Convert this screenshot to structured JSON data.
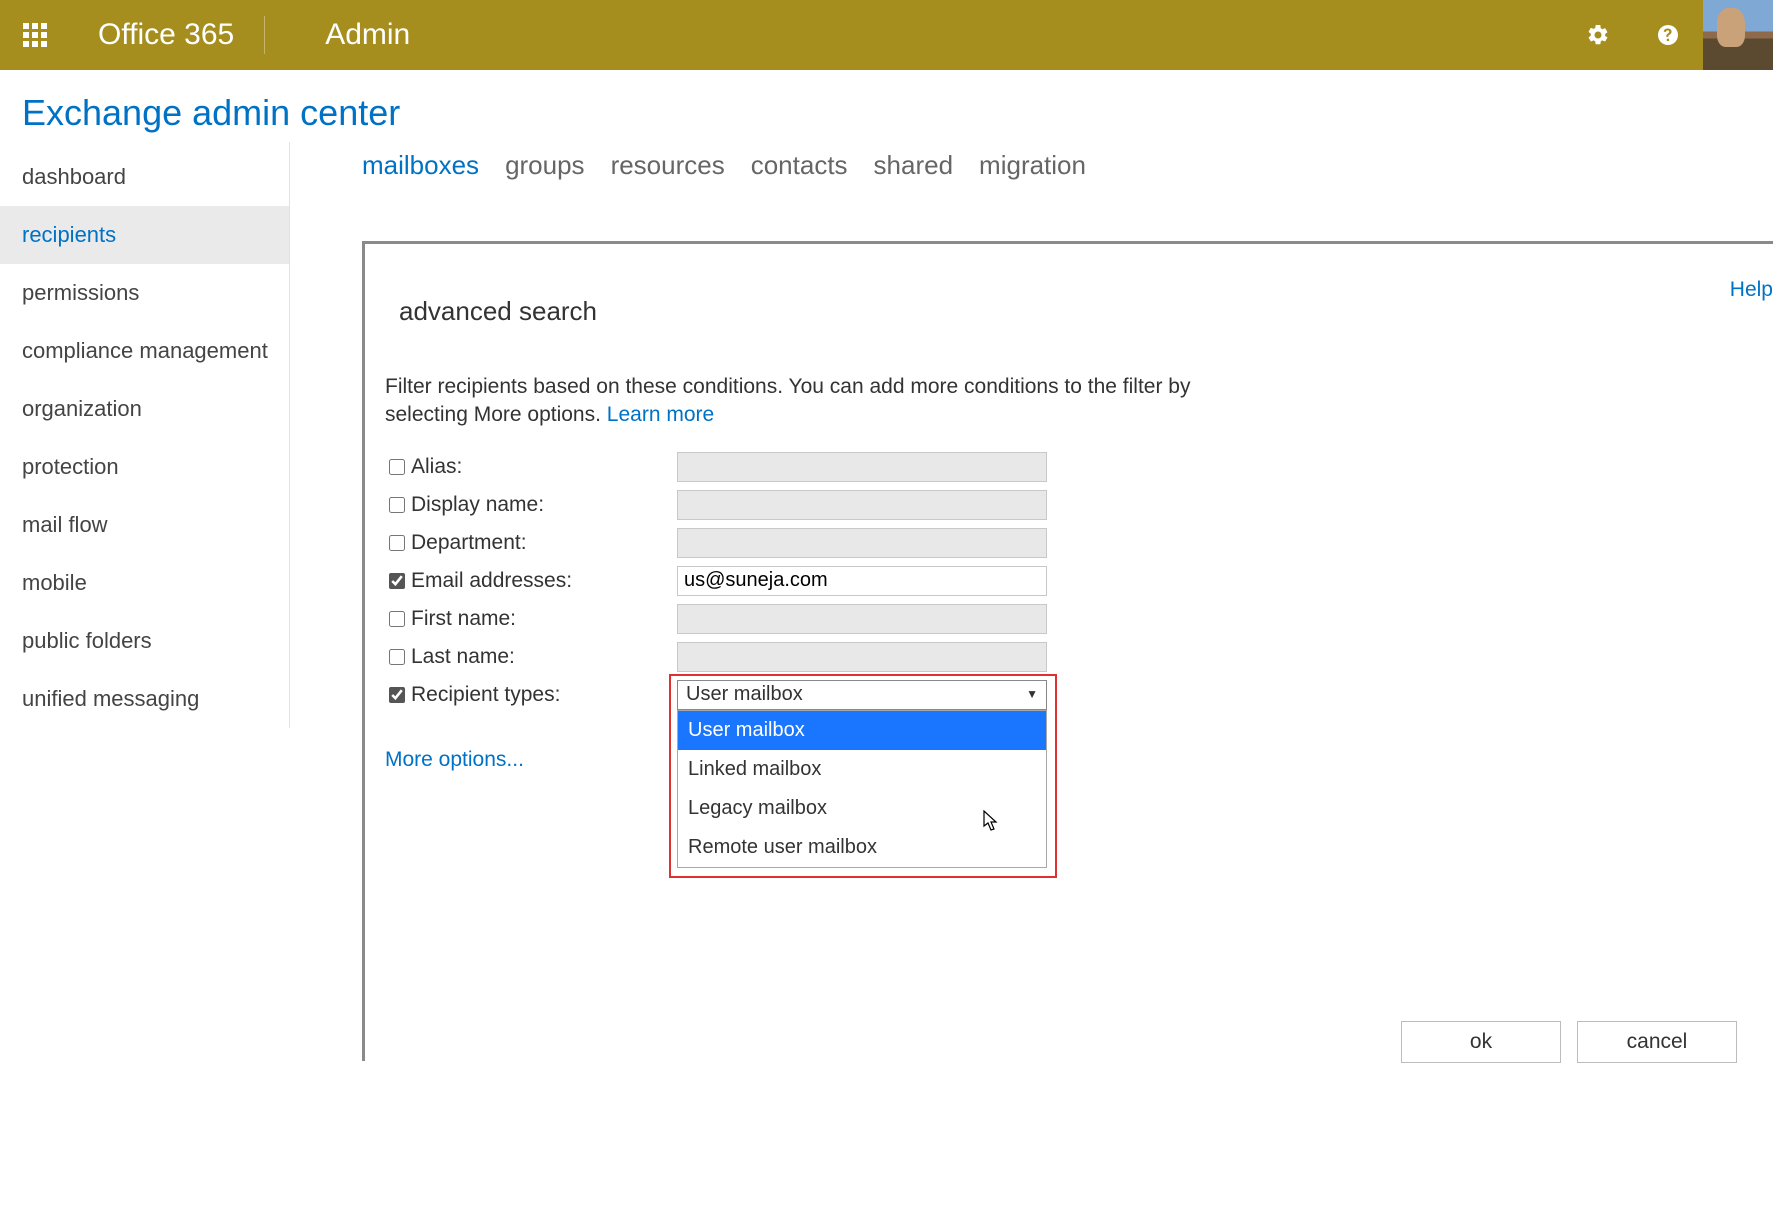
{
  "topbar": {
    "brand1": "Office 365",
    "brand2": "Admin"
  },
  "page_title": "Exchange admin center",
  "sidebar": {
    "items": [
      {
        "label": "dashboard",
        "selected": false
      },
      {
        "label": "recipients",
        "selected": true
      },
      {
        "label": "permissions",
        "selected": false
      },
      {
        "label": "compliance management",
        "selected": false
      },
      {
        "label": "organization",
        "selected": false
      },
      {
        "label": "protection",
        "selected": false
      },
      {
        "label": "mail flow",
        "selected": false
      },
      {
        "label": "mobile",
        "selected": false
      },
      {
        "label": "public folders",
        "selected": false
      },
      {
        "label": "unified messaging",
        "selected": false
      }
    ]
  },
  "subtabs": [
    {
      "label": "mailboxes",
      "selected": true
    },
    {
      "label": "groups",
      "selected": false
    },
    {
      "label": "resources",
      "selected": false
    },
    {
      "label": "contacts",
      "selected": false
    },
    {
      "label": "shared",
      "selected": false
    },
    {
      "label": "migration",
      "selected": false
    }
  ],
  "card": {
    "title": "advanced search",
    "help": "Help",
    "intro_text": "Filter recipients based on these conditions. You can add more conditions to the filter by selecting More options. ",
    "learn_more": "Learn more",
    "more_options": "More options...",
    "ok": "ok",
    "cancel": "cancel",
    "rows": {
      "alias": {
        "label": "Alias:",
        "checked": false,
        "value": ""
      },
      "display": {
        "label": "Display name:",
        "checked": false,
        "value": ""
      },
      "department": {
        "label": "Department:",
        "checked": false,
        "value": ""
      },
      "email": {
        "label": "Email addresses:",
        "checked": true,
        "value": "us@suneja.com"
      },
      "first": {
        "label": "First name:",
        "checked": false,
        "value": ""
      },
      "last": {
        "label": "Last name:",
        "checked": false,
        "value": ""
      },
      "recipient_types": {
        "label": "Recipient types:",
        "checked": true,
        "value": "User mailbox"
      }
    },
    "recipient_types_options": [
      "User mailbox",
      "Linked mailbox",
      "Legacy mailbox",
      "Remote user mailbox"
    ]
  }
}
